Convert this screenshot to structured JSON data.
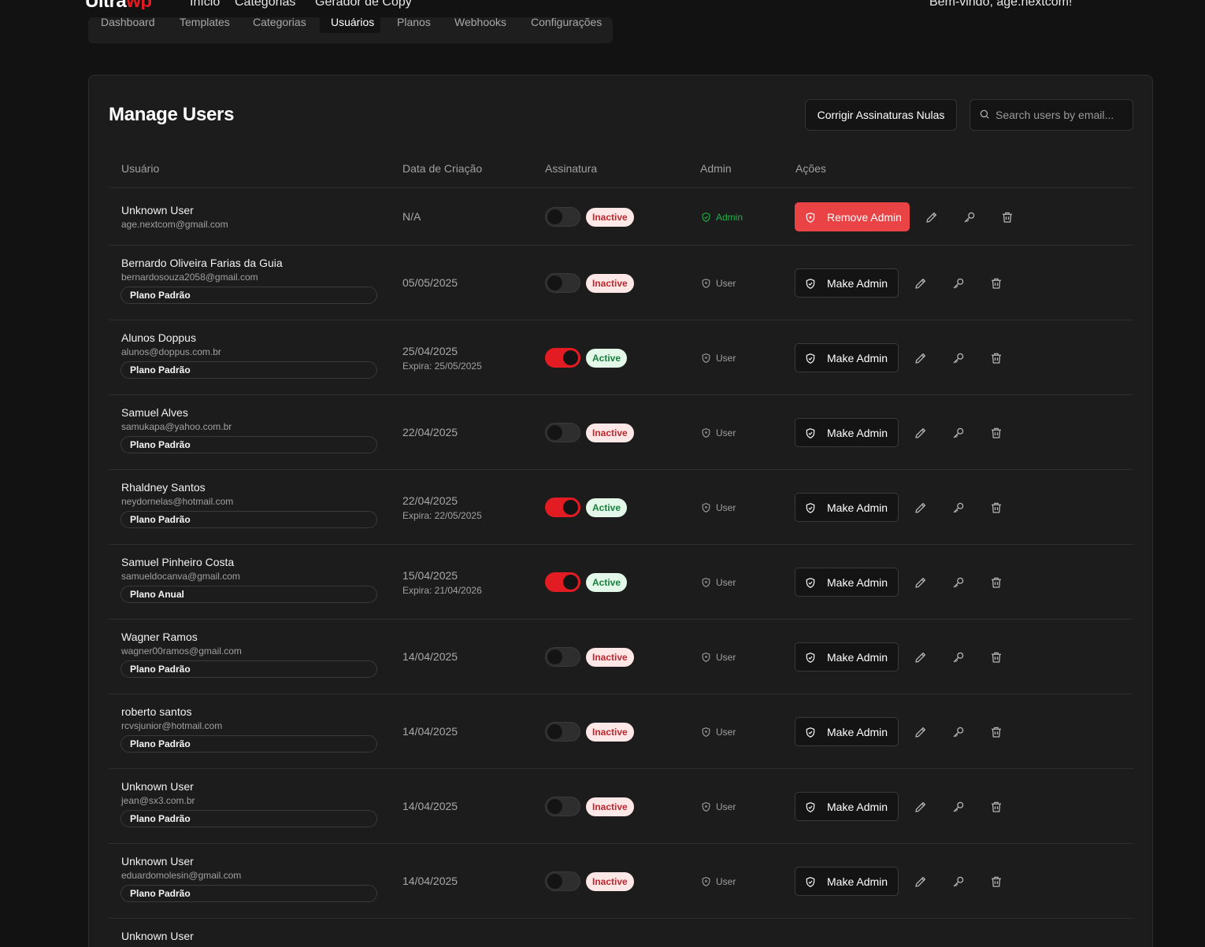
{
  "topnav": {
    "logo_a": "Ultra",
    "logo_b": "wp",
    "links": [
      "Início",
      "Categorias",
      "Gerador de Copy"
    ],
    "welcome": "Bem-vindo, age.nextcom!"
  },
  "tabs": [
    "Dashboard",
    "Templates",
    "Categorias",
    "Usuários",
    "Planos",
    "Webhooks",
    "Configurações"
  ],
  "active_tab": "Usuários",
  "card": {
    "title": "Manage Users",
    "fix_button": "Corrigir Assinaturas Nulas",
    "search_placeholder": "Search users by email..."
  },
  "columns": [
    "Usuário",
    "Data de Criação",
    "Assinatura",
    "Admin",
    "Ações"
  ],
  "users": [
    {
      "name": "Unknown User",
      "email": "age.nextcom@gmail.com",
      "plan": "",
      "date": "N/A",
      "expira": "",
      "active": false,
      "status": "Inactive",
      "role": "Admin",
      "action": "Remove Admin"
    },
    {
      "name": "Bernardo Oliveira Farias da Guia",
      "email": "bernardosouza2058@gmail.com",
      "plan": "Plano Padrão",
      "date": "05/05/2025",
      "expira": "",
      "active": false,
      "status": "Inactive",
      "role": "User",
      "action": "Make Admin"
    },
    {
      "name": "Alunos Doppus",
      "email": "alunos@doppus.com.br",
      "plan": "Plano Padrão",
      "date": "25/04/2025",
      "expira": "Expira: 25/05/2025",
      "active": true,
      "status": "Active",
      "role": "User",
      "action": "Make Admin"
    },
    {
      "name": "Samuel Alves",
      "email": "samukapa@yahoo.com.br",
      "plan": "Plano Padrão",
      "date": "22/04/2025",
      "expira": "",
      "active": false,
      "status": "Inactive",
      "role": "User",
      "action": "Make Admin"
    },
    {
      "name": "Rhaldney Santos",
      "email": "neydornelas@hotmail.com",
      "plan": "Plano Padrão",
      "date": "22/04/2025",
      "expira": "Expira: 22/05/2025",
      "active": true,
      "status": "Active",
      "role": "User",
      "action": "Make Admin"
    },
    {
      "name": "Samuel Pinheiro Costa",
      "email": "samueldocanva@gmail.com",
      "plan": "Plano Anual",
      "date": "15/04/2025",
      "expira": "Expira: 21/04/2026",
      "active": true,
      "status": "Active",
      "role": "User",
      "action": "Make Admin"
    },
    {
      "name": "Wagner Ramos",
      "email": "wagner00ramos@gmail.com",
      "plan": "Plano Padrão",
      "date": "14/04/2025",
      "expira": "",
      "active": false,
      "status": "Inactive",
      "role": "User",
      "action": "Make Admin"
    },
    {
      "name": "roberto santos",
      "email": "rcvsjunior@hotmail.com",
      "plan": "Plano Padrão",
      "date": "14/04/2025",
      "expira": "",
      "active": false,
      "status": "Inactive",
      "role": "User",
      "action": "Make Admin"
    },
    {
      "name": "Unknown User",
      "email": "jean@sx3.com.br",
      "plan": "Plano Padrão",
      "date": "14/04/2025",
      "expira": "",
      "active": false,
      "status": "Inactive",
      "role": "User",
      "action": "Make Admin"
    },
    {
      "name": "Unknown User",
      "email": "eduardomolesin@gmail.com",
      "plan": "Plano Padrão",
      "date": "14/04/2025",
      "expira": "",
      "active": false,
      "status": "Inactive",
      "role": "User",
      "action": "Make Admin"
    },
    {
      "name": "Unknown User",
      "email": "",
      "plan": "",
      "date": "",
      "expira": "",
      "active": false,
      "status": "",
      "role": "",
      "action": ""
    }
  ],
  "colors": {
    "accent": "#e31b23",
    "admin_green": "#22b04b",
    "remove_red": "#e94346"
  },
  "icons": {
    "edit": "pencil-icon",
    "key": "key-icon",
    "delete": "trash-icon",
    "shield": "shield-icon"
  }
}
